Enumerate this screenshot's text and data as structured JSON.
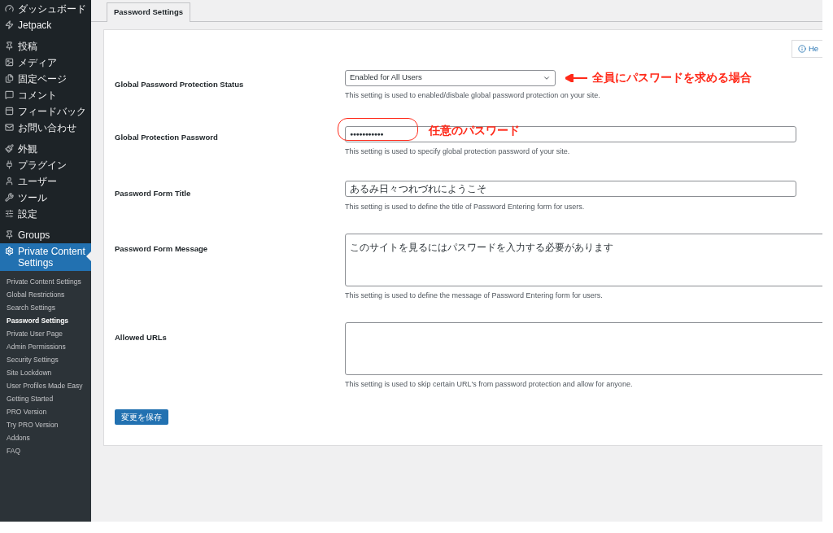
{
  "sidebar": {
    "menu_groups": [
      [
        {
          "label": "ダッシュボード",
          "selected": false
        },
        {
          "label": "Jetpack",
          "selected": false
        }
      ],
      [
        {
          "label": "投稿",
          "selected": false
        },
        {
          "label": "メディア",
          "selected": false
        },
        {
          "label": "固定ページ",
          "selected": false
        },
        {
          "label": "コメント",
          "selected": false
        },
        {
          "label": "フィードバック",
          "selected": false
        },
        {
          "label": "お問い合わせ",
          "selected": false
        }
      ],
      [
        {
          "label": "外観",
          "selected": false
        },
        {
          "label": "プラグイン",
          "selected": false
        },
        {
          "label": "ユーザー",
          "selected": false
        },
        {
          "label": "ツール",
          "selected": false
        },
        {
          "label": "設定",
          "selected": false
        }
      ],
      [
        {
          "label": "Groups",
          "selected": false
        },
        {
          "label": "Private Content Settings",
          "selected": true
        }
      ]
    ],
    "submenu": [
      {
        "label": "Private Content Settings",
        "selected": false
      },
      {
        "label": "Global Restrictions",
        "selected": false
      },
      {
        "label": "Search Settings",
        "selected": false
      },
      {
        "label": "Password Settings",
        "selected": true
      },
      {
        "label": "Private User Page",
        "selected": false
      },
      {
        "label": "Admin Permissions",
        "selected": false
      },
      {
        "label": "Security Settings",
        "selected": false
      },
      {
        "label": "Site Lockdown",
        "selected": false
      },
      {
        "label": "User Profiles Made Easy",
        "selected": false
      },
      {
        "label": "Getting Started",
        "selected": false
      },
      {
        "label": "PRO Version",
        "selected": false
      },
      {
        "label": "Try PRO Version",
        "selected": false
      },
      {
        "label": "Addons",
        "selected": false
      },
      {
        "label": "FAQ",
        "selected": false
      }
    ]
  },
  "tabs": [
    {
      "label": "Password Settings",
      "selected": true
    }
  ],
  "help_button": "He",
  "fields": [
    {
      "kind": "select",
      "label": "Global Password Protection Status",
      "value": "Enabled for All Users",
      "description": "This setting is used to enabled/disbale global password protection on your site.",
      "annotation": "全員にパスワードを求める場合"
    },
    {
      "kind": "password",
      "label": "Global Protection Password",
      "value": "●●●●●●●●●●●",
      "description": "This setting is used to specify global protection password of your site.",
      "annotation": "任意のパスワード"
    },
    {
      "kind": "text",
      "label": "Password Form Title",
      "value": "あるみ日々つれづれにようこそ",
      "description": "This setting is used to define the title of Password Entering form for users."
    },
    {
      "kind": "textarea",
      "label": "Password Form Message",
      "value": "このサイトを見るにはパスワードを入力する必要があります",
      "description": "This setting is used to define the message of Password Entering form for users."
    },
    {
      "kind": "textarea",
      "label": "Allowed URLs",
      "description": "This setting is used to skip certain URL's from password protection and allow for anyone."
    }
  ],
  "save_button": "変更を保存"
}
